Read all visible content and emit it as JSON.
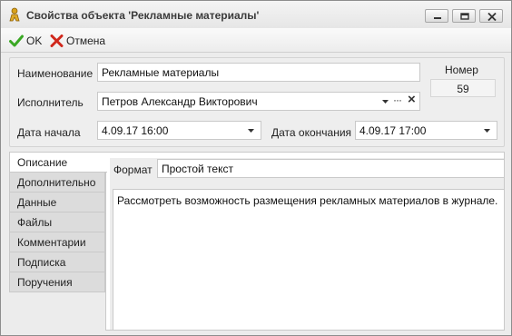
{
  "window": {
    "title": "Свойства объекта 'Рекламные материалы'"
  },
  "toolbar": {
    "ok_label": "OK",
    "cancel_label": "Отмена"
  },
  "form": {
    "name_label": "Наименование",
    "name_value": "Рекламные материалы",
    "number_label": "Номер",
    "number_value": "59",
    "executor_label": "Исполнитель",
    "executor_value": "Петров Александр Викторович",
    "executor_more": "···",
    "executor_clear": "×",
    "start_label": "Дата начала",
    "start_value": "4.09.17 16:00",
    "end_label": "Дата окончания",
    "end_value": "4.09.17 17:00"
  },
  "tabs": [
    {
      "label": "Описание",
      "active": true
    },
    {
      "label": "Дополнительно",
      "active": false
    },
    {
      "label": "Данные",
      "active": false
    },
    {
      "label": "Файлы",
      "active": false
    },
    {
      "label": "Комментарии",
      "active": false
    },
    {
      "label": "Подписка",
      "active": false
    },
    {
      "label": "Поручения",
      "active": false
    }
  ],
  "description": {
    "format_label": "Формат",
    "format_value": "Простой текст",
    "text": "Рассмотреть возможность размещения рекламных материалов в журнале."
  },
  "icons": {
    "title": "person-icon",
    "ok": "check-icon",
    "cancel": "cross-icon",
    "minimize": "minimize-icon",
    "maximize": "maximize-icon",
    "close": "close-icon"
  },
  "colors": {
    "ok_green": "#3aa824",
    "cancel_red": "#d0281c",
    "title_icon": "#d9a21b"
  }
}
